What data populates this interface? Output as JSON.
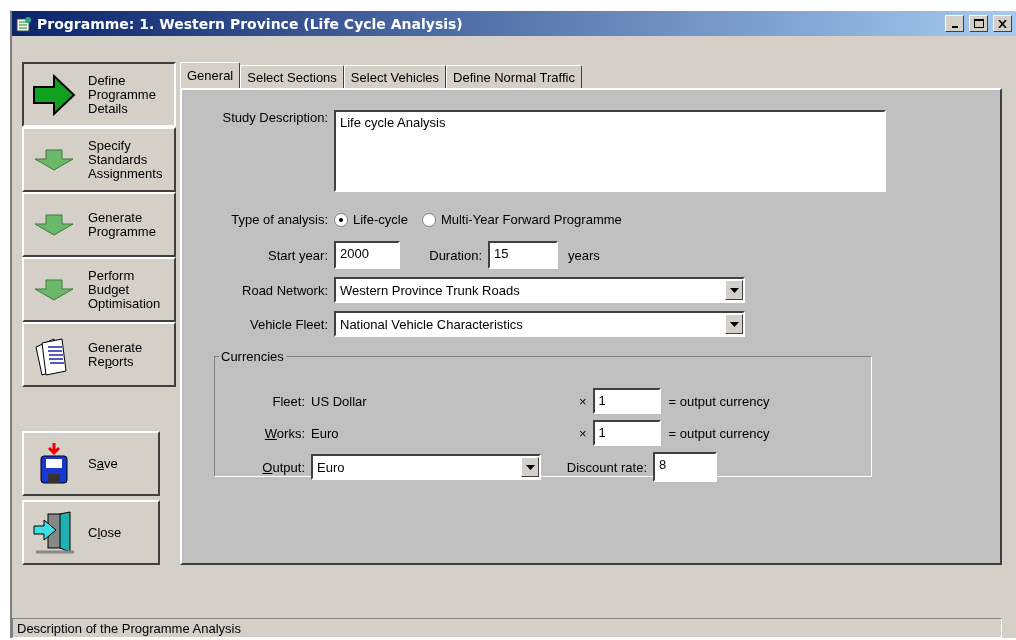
{
  "window": {
    "title": "Programme: 1. Western Province (Life Cycle Analysis)"
  },
  "nav": [
    {
      "kind": "step",
      "lines": [
        "Define",
        "Programme",
        "Details"
      ],
      "selected": true
    },
    {
      "kind": "step",
      "lines": [
        "Specify",
        "Standards",
        "Assignments"
      ],
      "selected": false
    },
    {
      "kind": "step",
      "lines": [
        "Generate",
        "Programme"
      ],
      "selected": false
    },
    {
      "kind": "step",
      "lines": [
        "Perform",
        "Budget",
        "Optimisation"
      ],
      "selected": false
    },
    {
      "kind": "reports",
      "lines": [
        "Generate",
        {
          "before": "Re",
          "key": "p",
          "after": "orts"
        }
      ],
      "selected": false
    }
  ],
  "actions": [
    {
      "kind": "save",
      "label": {
        "before": "S",
        "key": "a",
        "after": "ve"
      }
    },
    {
      "kind": "close",
      "label": {
        "before": "C",
        "key": "l",
        "after": "ose"
      }
    }
  ],
  "tabs": [
    {
      "label": "General",
      "selected": true
    },
    {
      "label": "Select Sections",
      "selected": false
    },
    {
      "label": "Select Vehicles",
      "selected": false
    },
    {
      "label": "Define Normal Traffic",
      "selected": false
    }
  ],
  "form": {
    "study_description": {
      "label": "Study Description:",
      "value": "Life cycle Analysis"
    },
    "type_of_analysis": {
      "label": "Type of analysis:",
      "options": [
        {
          "label": "Life-cycle",
          "selected": true
        },
        {
          "label": "Multi-Year Forward Programme",
          "selected": false
        }
      ]
    },
    "start_year": {
      "label": "Start year:",
      "value": "2000"
    },
    "duration": {
      "label": "Duration:",
      "value": "15",
      "unit": "years"
    },
    "road_network": {
      "label": "Road Network:",
      "value": "Western Province Trunk Roads"
    },
    "vehicle_fleet": {
      "label": "Vehicle Fleet:",
      "value": "National Vehicle Characteristics"
    },
    "currencies": {
      "title": "Currencies",
      "rows": [
        {
          "label": {
            "after": "Fleet:"
          },
          "currency": "US Dollar",
          "times": "×",
          "factor": "1",
          "suffix": "= output currency"
        },
        {
          "label": {
            "key": "W",
            "after": "orks:"
          },
          "currency": "Euro",
          "times": "×",
          "factor": "1",
          "suffix": "= output currency"
        }
      ],
      "output": {
        "label": {
          "key": "O",
          "after": "utput:"
        },
        "value": "Euro"
      },
      "discount_rate": {
        "label": "Discount rate:",
        "value": "8"
      }
    }
  },
  "status_bar": {
    "text": "Description of the Programme Analysis"
  }
}
